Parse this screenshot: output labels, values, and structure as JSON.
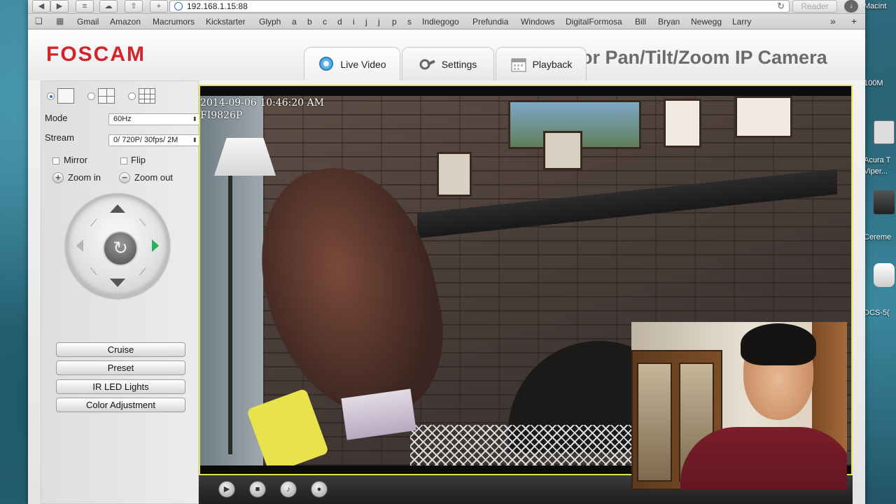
{
  "browser": {
    "address": "192.168.1.15:88",
    "reader_label": "Reader",
    "bookmarks": [
      "Gmail",
      "Amazon",
      "Macrumors",
      "Kickstarter",
      "Glyph",
      "a",
      "b",
      "c",
      "d",
      "i",
      "j",
      "j",
      "p",
      "s",
      "Indiegogo",
      "Prefundia",
      "Windows",
      "DigitalFormosa",
      "Bill",
      "Bryan",
      "Newegg",
      "Larry"
    ]
  },
  "desktop": {
    "labels": [
      "Macint",
      "100M",
      "Acura T",
      "Viper...",
      "Cereme",
      "DCS-5("
    ]
  },
  "header": {
    "logo": "FOSCAM",
    "title": "or Pan/Tilt/Zoom IP Camera",
    "tabs": [
      "Live Video",
      "Settings",
      "Playback"
    ]
  },
  "panel": {
    "mode_label": "Mode",
    "mode_value": "60Hz",
    "stream_label": "Stream",
    "stream_value": "0/ 720P/ 30fps/ 2M",
    "mirror_label": "Mirror",
    "flip_label": "Flip",
    "zoom_in_label": "Zoom in",
    "zoom_out_label": "Zoom out",
    "buttons": [
      "Cruise",
      "Preset",
      "IR LED Lights",
      "Color Adjustment"
    ]
  },
  "video": {
    "timestamp": "2014-09-06 10:46:20 AM",
    "camera_id": "FI9826P"
  },
  "colors": {
    "brand": "#d3242c",
    "video_border": "#dfe24a"
  }
}
